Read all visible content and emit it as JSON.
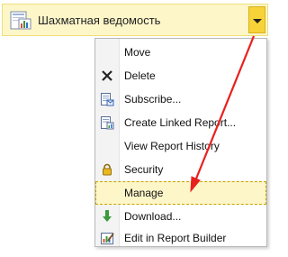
{
  "item": {
    "title": "Шахматная ведомость",
    "icon": "report-icon"
  },
  "menu": {
    "items": [
      {
        "label": "Move",
        "icon": ""
      },
      {
        "label": "Delete",
        "icon": "delete-x-icon"
      },
      {
        "label": "Subscribe...",
        "icon": "subscribe-icon"
      },
      {
        "label": "Create Linked Report...",
        "icon": "linked-report-icon"
      },
      {
        "label": "View Report History",
        "icon": ""
      },
      {
        "label": "Security",
        "icon": "lock-icon"
      },
      {
        "label": "Manage",
        "icon": ""
      },
      {
        "label": "Download...",
        "icon": "download-icon"
      },
      {
        "label": "Edit in Report Builder",
        "icon": "report-builder-icon"
      }
    ]
  },
  "colors": {
    "highlight_bg": "#fdf6c9",
    "dropdown_button": "#f7d338",
    "annotation_arrow": "#e8201e"
  }
}
